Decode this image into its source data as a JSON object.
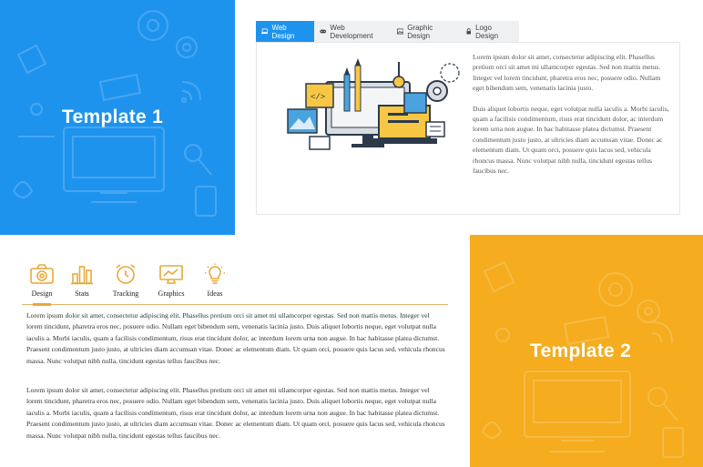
{
  "template1": {
    "title": "Template 1",
    "tabs": [
      {
        "label": "Web Design",
        "icon": "laptop-icon",
        "active": true
      },
      {
        "label": "Web Development",
        "icon": "gamepad-icon",
        "active": false
      },
      {
        "label": "Graphic Design",
        "icon": "image-icon",
        "active": false
      },
      {
        "label": "Logo Design",
        "icon": "lock-icon",
        "active": false
      }
    ],
    "paragraphs": [
      "Lorem ipsum dolor sit amet, consectetur adipiscing elit. Phasellus pretium orci sit amet mi ullamcorper egestas. Sed non mattis metus. Integer vel lorem tincidunt, pharetra eros nec, posuere odio. Nullam eget bibendum sem, venenatis lacinia justo.",
      "Duis aliquet lobortis neque, eget volutpat nulla iaculis a. Morbi iaculis, quam a facilisis condimentum, risus erat tincidunt dolor, ac interdum lorem urna non augue. In hac habitasse platea dictumst. Praesent condimentum justo justo, at ultricies diam accumsan vitae. Donec ac elementum diam. Ut quam orci, posuere quis lacus sed, vehicula rhoncus massa. Nunc volutpat nibh nulla, tincidunt egestas tellus faucibus nec."
    ],
    "illustration": "web-design-illustration"
  },
  "template2": {
    "title": "Template 2",
    "tabs": [
      {
        "label": "Design",
        "icon": "camera-icon",
        "active": true
      },
      {
        "label": "Stats",
        "icon": "bar-chart-icon",
        "active": false
      },
      {
        "label": "Tracking",
        "icon": "alarm-clock-icon",
        "active": false
      },
      {
        "label": "Graphics",
        "icon": "monitor-icon",
        "active": false
      },
      {
        "label": "Ideas",
        "icon": "lightbulb-icon",
        "active": false
      }
    ],
    "paragraphs": [
      "Lorem ipsum dolor sit amet, consectetur adipiscing elit. Phasellus pretium orci sit amet mi ullamcorper egestas. Sed non mattis metus. Integer vel lorem tincidunt, pharetra eros nec, posuere odio. Nullam eget bibendum sem, venenatis lacinia justo. Duis aliquet lobortis neque, eget volutpat nulla iaculis a. Morbi iaculis, quam a facilisis condimentum, risus erat tincidunt dolor, ac interdum lorem urna non augue. In hac habitasse platea dictumst. Praesent condimentum justo justo, at ultricies diam accumsan vitae. Donec ac elementum diam. Ut quam orci, posuere quis lacus sed, vehicula rhoncus massa. Nunc volutpat nibh nulla, tincidunt egestas tellus faucibus nec.",
      "Lorem ipsum dolor sit amet, consectetur adipiscing elit. Phasellus pretium orci sit amet mi ullamcorper egestas. Sed non mattis metus. Integer vel lorem tincidunt, pharetra eros nec, posuere odio. Nullam eget bibendum sem, venenatis lacinia justo. Duis aliquet lobortis neque, eget volutpat nulla iaculis a. Morbi iaculis, quam a facilisis condimentum, risus erat tincidunt dolor, ac interdum lorem urna non augue. In hac habitasse platea dictumst. Praesent condimentum justo justo, at ultricies diam accumsan vitae. Donec ac elementum diam. Ut quam orci, posuere quis lacus sed, vehicula rhoncus massa. Nunc volutpat nibh nulla, tincidunt egestas tellus faucibus nec."
    ]
  },
  "colors": {
    "blue": "#1e93ee",
    "orange": "#f5ac1e",
    "icon_orange": "#e8a93a"
  }
}
